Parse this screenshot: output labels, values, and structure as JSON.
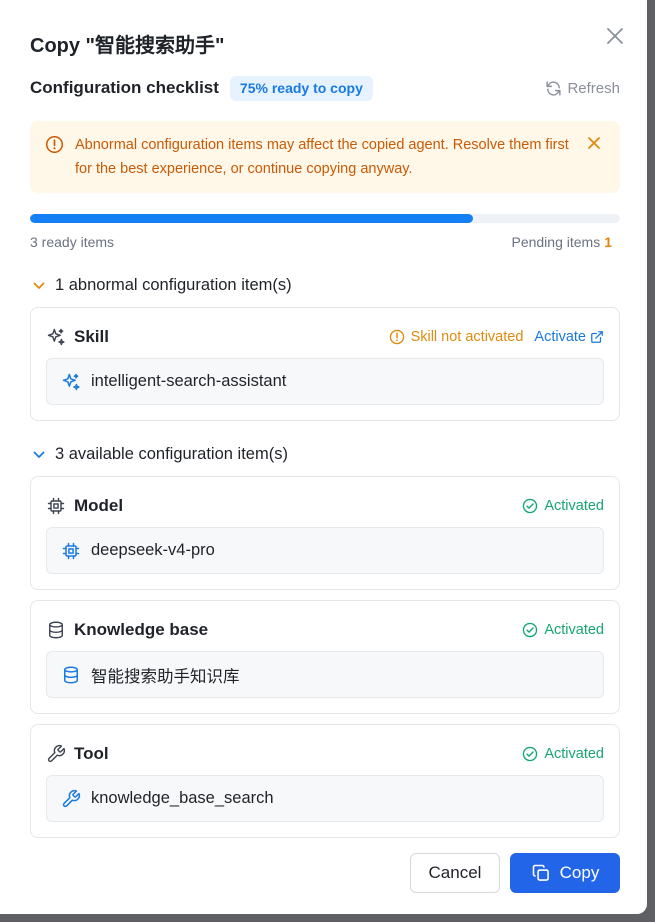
{
  "dialog": {
    "title": "Copy \"智能搜索助手\"",
    "checklist_title": "Configuration checklist",
    "ready_badge": "75% ready to copy",
    "refresh_label": "Refresh"
  },
  "alert": {
    "text": "Abnormal configuration items may affect the copied agent. Resolve them first for the best experience, or continue copying anyway."
  },
  "progress": {
    "percent": 75,
    "ready_text": "3 ready items",
    "pending_label": "Pending items",
    "pending_count": "1"
  },
  "abnormal_section": {
    "header": "1 abnormal configuration item(s)",
    "items": [
      {
        "title": "Skill",
        "status": "Skill not activated",
        "action": "Activate",
        "value": "intelligent-search-assistant"
      }
    ]
  },
  "available_section": {
    "header": "3 available configuration item(s)",
    "items": [
      {
        "title": "Model",
        "status": "Activated",
        "value": "deepseek-v4-pro"
      },
      {
        "title": "Knowledge base",
        "status": "Activated",
        "value": "智能搜索助手知识库"
      },
      {
        "title": "Tool",
        "status": "Activated",
        "value": "knowledge_base_search"
      }
    ]
  },
  "footer": {
    "cancel_label": "Cancel",
    "copy_label": "Copy"
  },
  "colors": {
    "accent": "#1a7ae0",
    "primary_button": "#2365e8",
    "success": "#17a672",
    "warning": "#e08a0d"
  }
}
